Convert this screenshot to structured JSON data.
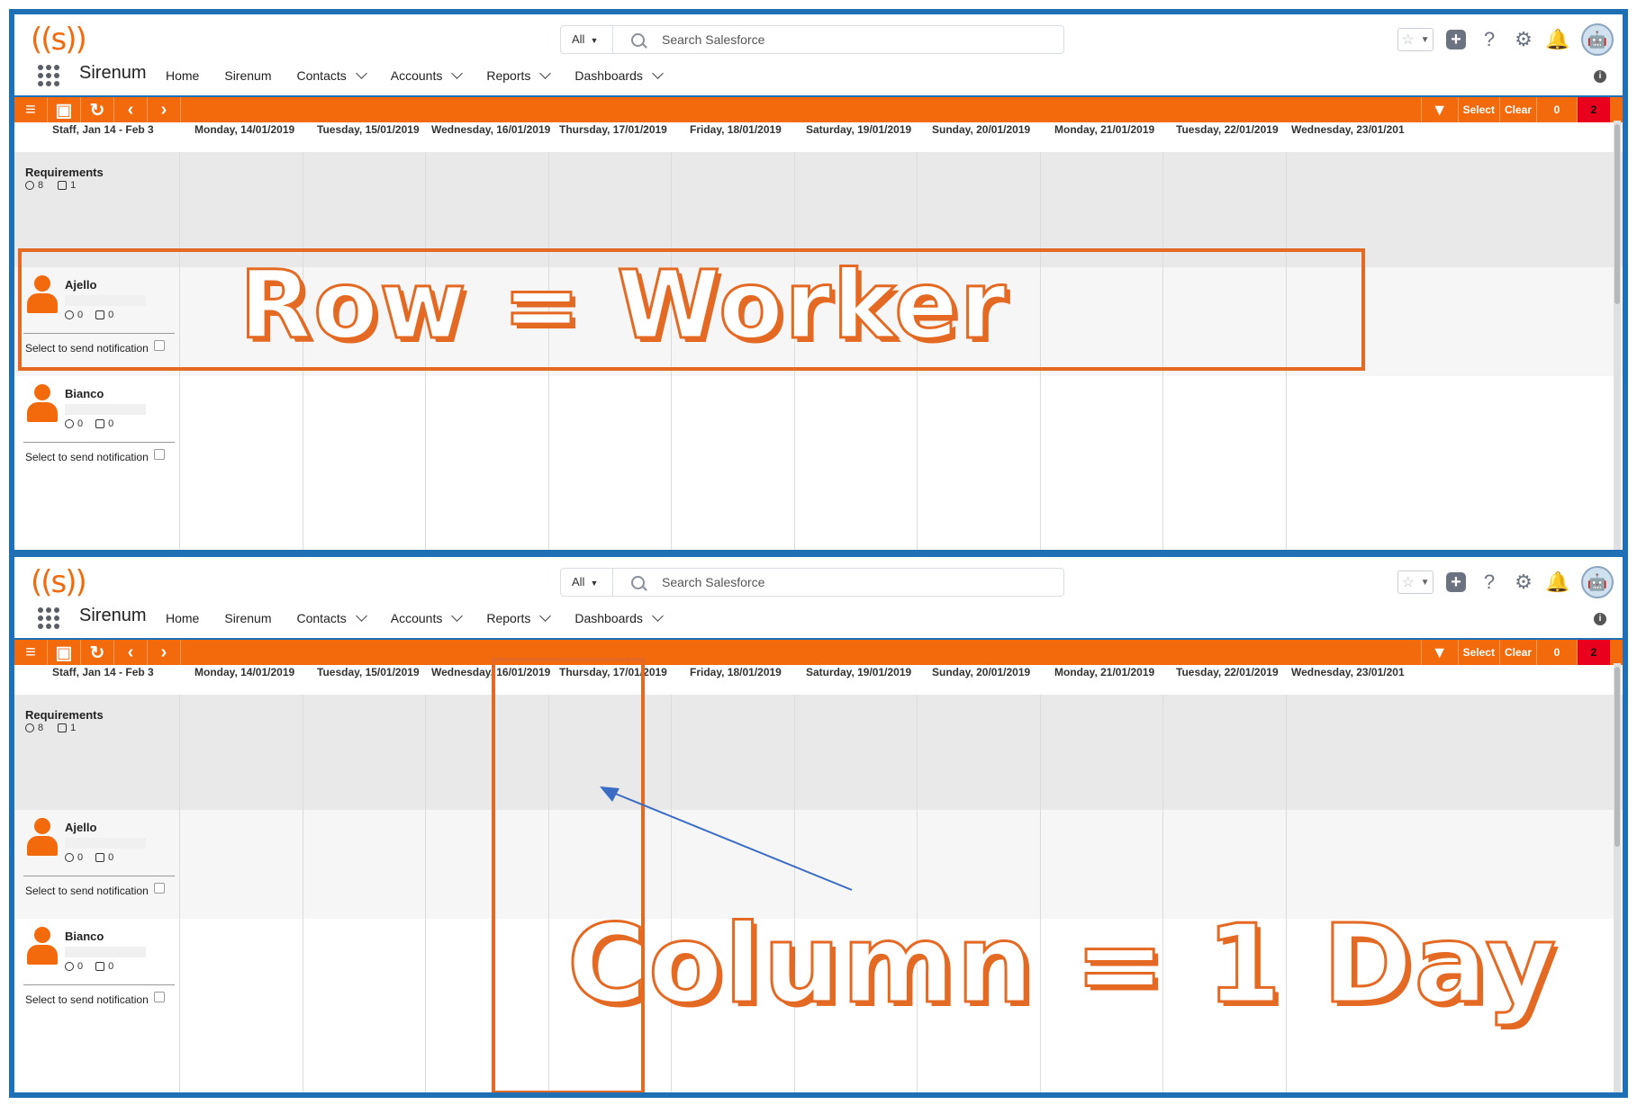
{
  "header": {
    "logo_text": "((s))",
    "search_scope": "All",
    "search_placeholder": "Search Salesforce",
    "app_name": "Sirenum",
    "nav_items": [
      "Home",
      "Sirenum",
      "Contacts",
      "Accounts",
      "Reports",
      "Dashboards"
    ],
    "nav_has_dropdown": [
      false,
      false,
      true,
      true,
      true,
      true
    ],
    "icons": [
      "star-icon",
      "dropdown-icon",
      "plus-icon",
      "help-icon",
      "gear-icon",
      "bell-icon",
      "avatar"
    ]
  },
  "toolbar": {
    "buttons": [
      "menu-icon",
      "save-icon",
      "refresh-icon",
      "prev-icon",
      "next-icon"
    ],
    "select_label": "Select",
    "clear_label": "Clear",
    "count_zero": "0",
    "count_alert": "2",
    "accent_color": "#f26a0c",
    "alert_color": "#e8001c"
  },
  "schedule": {
    "range_label": "Staff, Jan 14 - Feb 3",
    "days": [
      "Monday, 14/01/2019",
      "Tuesday, 15/01/2019",
      "Wednesday, 16/01/2019",
      "Thursday, 17/01/2019",
      "Friday, 18/01/2019",
      "Saturday, 19/01/2019",
      "Sunday, 20/01/2019",
      "Monday, 21/01/2019",
      "Tuesday, 22/01/2019",
      "Wednesday, 23/01/201"
    ],
    "requirements": {
      "title": "Requirements",
      "hours": "8",
      "shifts": "1"
    },
    "workers": [
      {
        "name": "Ajello",
        "hours": "0",
        "shifts": "0",
        "notify_label": "Select to send notification"
      },
      {
        "name": "Bianco",
        "hours": "0",
        "shifts": "0",
        "notify_label": "Select to send notification"
      }
    ]
  },
  "annotations": {
    "row_label": "Row = Worker",
    "column_label": "Column = 1 Day",
    "color": "#e46a24",
    "arrow_color": "#3a6cc4"
  }
}
